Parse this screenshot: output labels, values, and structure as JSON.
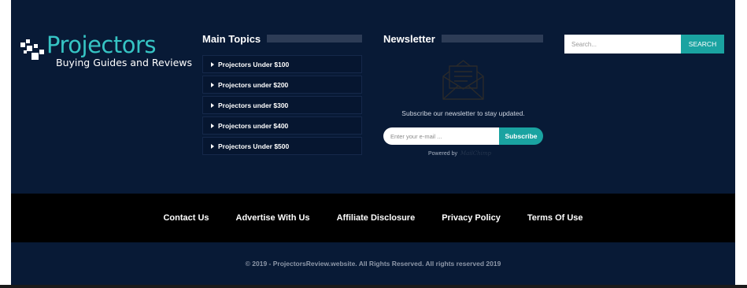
{
  "logo": {
    "title": "Projectors",
    "subtitle": "Buying Guides and Reviews",
    "accent_color": "#36c4c4"
  },
  "main_topics": {
    "heading": "Main Topics",
    "items": [
      {
        "label": "Projectors Under $100"
      },
      {
        "label": "Projectors under $200"
      },
      {
        "label": "Projectors under $300"
      },
      {
        "label": "Projectors under $400"
      },
      {
        "label": "Projectors Under $500"
      }
    ]
  },
  "newsletter": {
    "heading": "Newsletter",
    "icon": "envelope-icon",
    "text": "Subscribe our newsletter to stay updated.",
    "email_placeholder": "Enter your e-mail ...",
    "subscribe_label": "Subscribe",
    "powered_by": "Powered by",
    "powered_brand": "MailChimp"
  },
  "search": {
    "placeholder": "Search...",
    "button_label": "SEARCH"
  },
  "bottom_nav": {
    "links": [
      {
        "label": "Contact Us"
      },
      {
        "label": "Advertise With Us"
      },
      {
        "label": "Affiliate Disclosure"
      },
      {
        "label": "Privacy Policy"
      },
      {
        "label": "Terms Of Use"
      }
    ]
  },
  "copyright": "© 2019 - ProjectorsReview.website. All Rights Reserved. All rights reserved 2019",
  "colors": {
    "footer_bg": "#081a36",
    "nav_bg": "#000000",
    "accent": "#1aa3a1"
  }
}
